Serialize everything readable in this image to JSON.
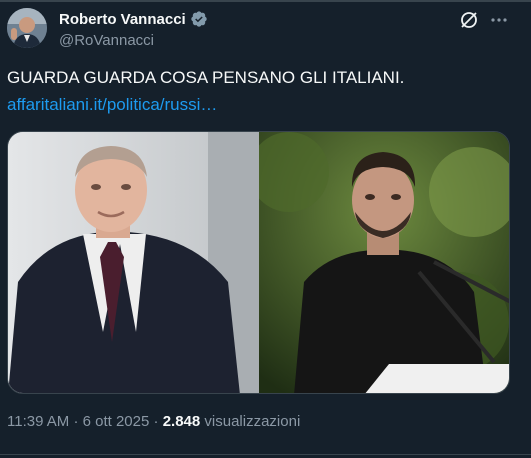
{
  "author": {
    "name": "Roberto Vannacci",
    "handle": "@RoVannacci"
  },
  "icons": {
    "avatar": "user-avatar",
    "verified": "verified-badge-icon",
    "grok": "grok-icon",
    "more": "more-options-icon"
  },
  "tweet": {
    "text": "GUARDA GUARDA COSA PENSANO GLI ITALIANI.",
    "link": "affaritaliani.it/politica/russi…"
  },
  "meta": {
    "time": "11:39 AM",
    "separator": "·",
    "date": "6 ott 2025",
    "views_count": "2.848",
    "views_label": "visualizzazioni"
  },
  "colors": {
    "background": "#15202b",
    "link": "#1d9bf0",
    "verified": "#829aab",
    "muted": "#8b98a5"
  }
}
